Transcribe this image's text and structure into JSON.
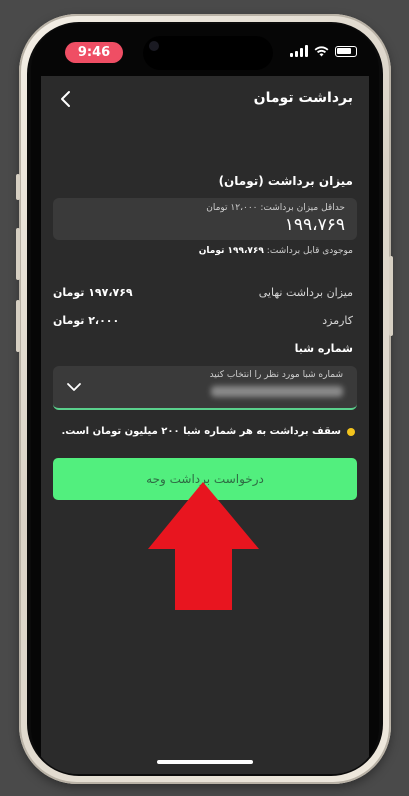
{
  "status_bar": {
    "time": "9:46"
  },
  "header": {
    "title": "برداشت تومان"
  },
  "form": {
    "amount_label": "میزان برداشت (تومان)",
    "amount_hint": "حداقل میزان برداشت: ۱۲،۰۰۰ تومان",
    "amount_value": "۱۹۹،۷۶۹",
    "available_label": "موجودی قابل برداشت:",
    "available_value": "۱۹۹،۷۶۹ تومان",
    "final_label": "میزان برداشت نهایی",
    "final_value": "۱۹۷،۷۶۹ تومان",
    "fee_label": "کارمزد",
    "fee_value": "۲،۰۰۰ تومان",
    "sheba_label": "شماره شبا",
    "sheba_hint": "شماره شبا مورد نظر را انتخاب کنید",
    "note": "سقف برداشت به هر شماره شبا ۲۰۰ میلیون تومان است.",
    "submit_label": "درخواست برداشت وجه"
  },
  "colors": {
    "accent": "#52ef7e",
    "arrow": "#e8151f",
    "note_dot": "#f2c31d",
    "time_pill": "#ef4e64"
  },
  "icons": {
    "back": "chevron-left-icon",
    "dropdown": "chevron-down-icon",
    "annotation": "up-arrow-icon"
  }
}
